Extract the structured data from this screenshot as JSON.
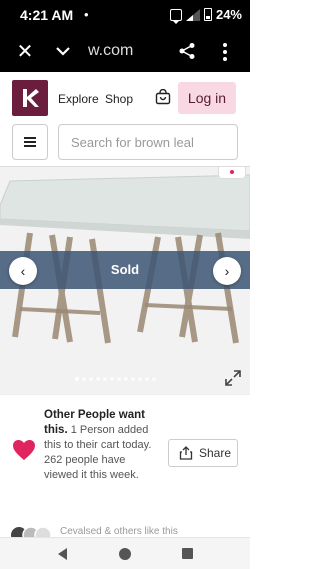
{
  "status_bar": {
    "time": "4:21 AM",
    "dot": "•",
    "battery": "24%"
  },
  "browser": {
    "url_text": "w.com",
    "close_glyph": "✕"
  },
  "header": {
    "nav_explore": "Explore",
    "nav_shop": "Shop",
    "login_label": "Log in"
  },
  "search": {
    "placeholder": "Search for brown leal"
  },
  "product": {
    "status_label": "Sold",
    "prev_glyph": "‹",
    "next_glyph": "›",
    "image_count": 12,
    "active_image": 1
  },
  "info": {
    "headline": "Other People want this.",
    "body": " 1 Person added this to their cart today. 262 people have viewed it this week.",
    "share_label": "Share"
  },
  "next_row": {
    "text": "Cevalsed & others like this"
  },
  "colors": {
    "brand": "#6b1d3e",
    "login_bg": "#f8d8e2",
    "sold_banner": "#3c5573",
    "heart": "#e0245e"
  }
}
